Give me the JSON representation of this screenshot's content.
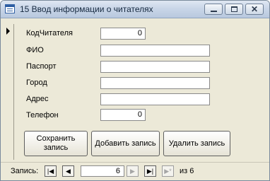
{
  "window": {
    "title": "15 Ввод информации о читателях"
  },
  "form": {
    "fields": [
      {
        "label": "КодЧитателя",
        "value": "0"
      },
      {
        "label": "ФИО",
        "value": ""
      },
      {
        "label": "Паспорт",
        "value": ""
      },
      {
        "label": "Город",
        "value": ""
      },
      {
        "label": "Адрес",
        "value": ""
      },
      {
        "label": "Телефон",
        "value": "0"
      }
    ],
    "buttons": {
      "save_line1": "Сохранить",
      "save_line2": "запись",
      "add": "Добавить запись",
      "delete": "Удалить запись"
    }
  },
  "nav": {
    "label": "Запись:",
    "current": "6",
    "of_text": "из 6",
    "icons": [
      "first-record-icon",
      "previous-record-icon",
      "next-record-icon",
      "last-record-icon",
      "new-record-icon"
    ]
  }
}
